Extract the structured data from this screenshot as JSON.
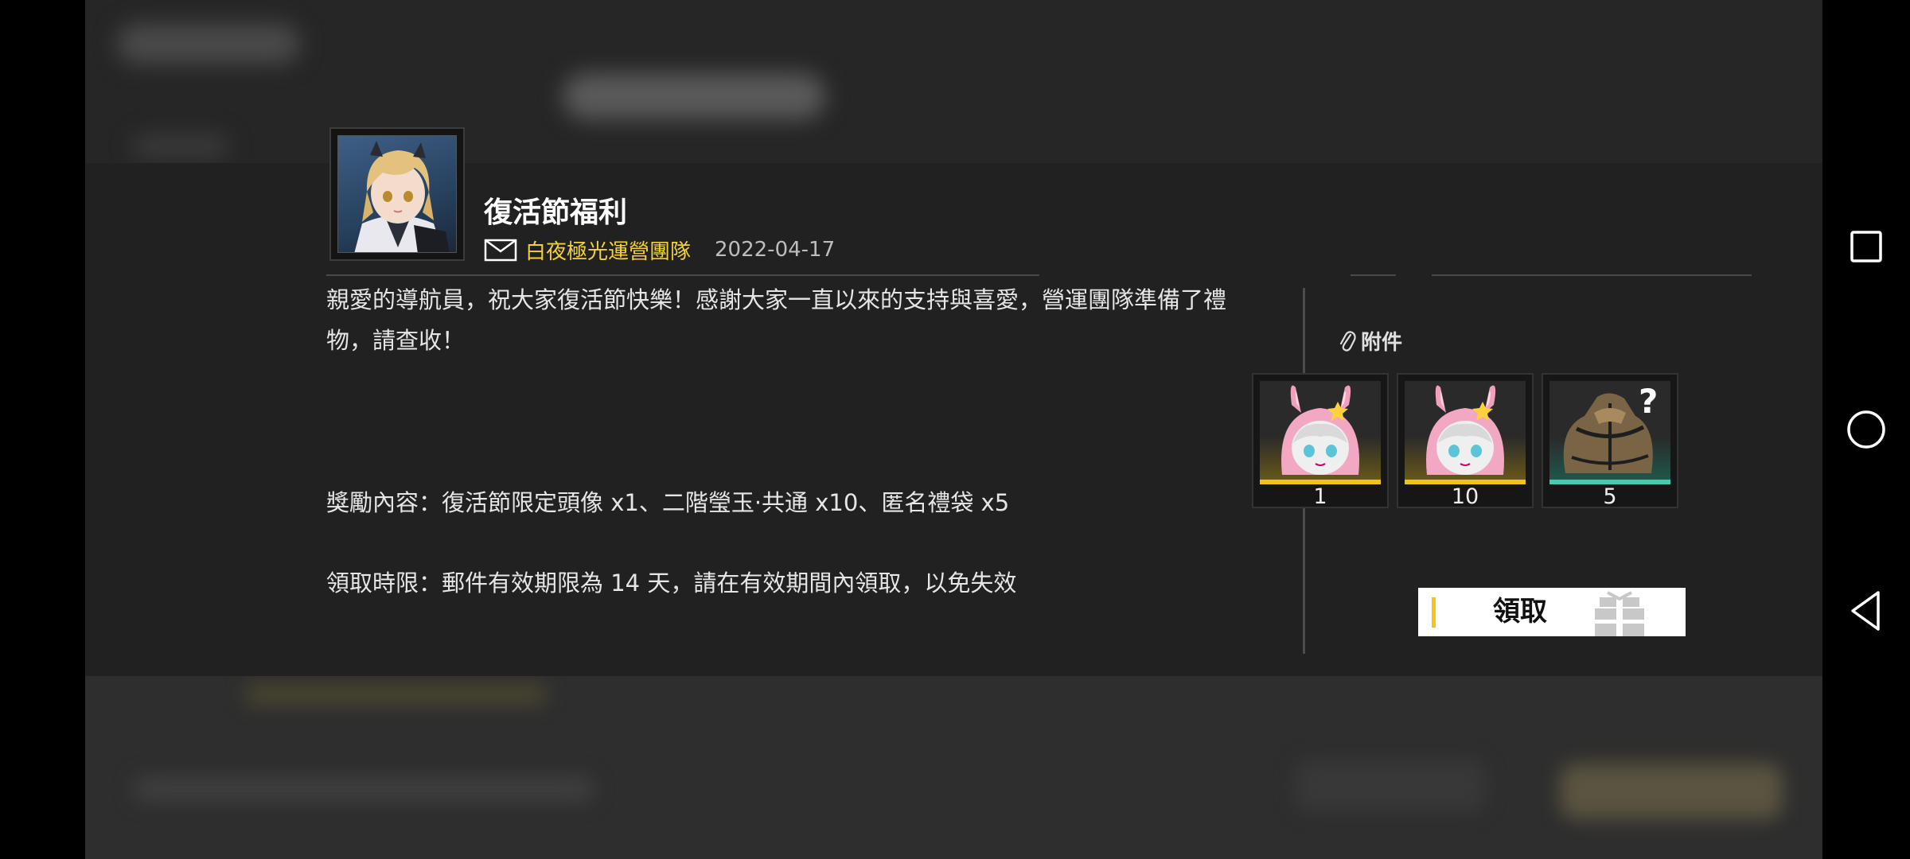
{
  "mail": {
    "title": "復活節福利",
    "sender": "白夜極光運營團隊",
    "date": "2022-04-17",
    "body": [
      "親愛的導航員，祝大家復活節快樂！感謝大家一直以來的支持與喜愛，營運團隊準備了禮物，請查收！",
      "獎勵內容：復活節限定頭像 x1、二階瑩玉·共通 x10、匿名禮袋 x5",
      "領取時限：郵件有效期限為 14 天，請在有效期間內領取，以免失效"
    ]
  },
  "attachments": {
    "label": "附件",
    "items": [
      {
        "count": "1",
        "rarity_color": "#f0c419",
        "icon": "bunny-hood-avatar-icon"
      },
      {
        "count": "10",
        "rarity_color": "#f0c419",
        "icon": "bunny-hood-avatar-icon"
      },
      {
        "count": "5",
        "rarity_color": "#3fcfb0",
        "icon": "mystery-bag-icon"
      }
    ]
  },
  "actions": {
    "claim_label": "領取"
  },
  "system_nav": {
    "buttons": [
      "recent-apps",
      "home",
      "back"
    ]
  },
  "colors": {
    "accent": "#f0c419",
    "sender": "#f2d13a",
    "teal": "#3fcfb0"
  }
}
